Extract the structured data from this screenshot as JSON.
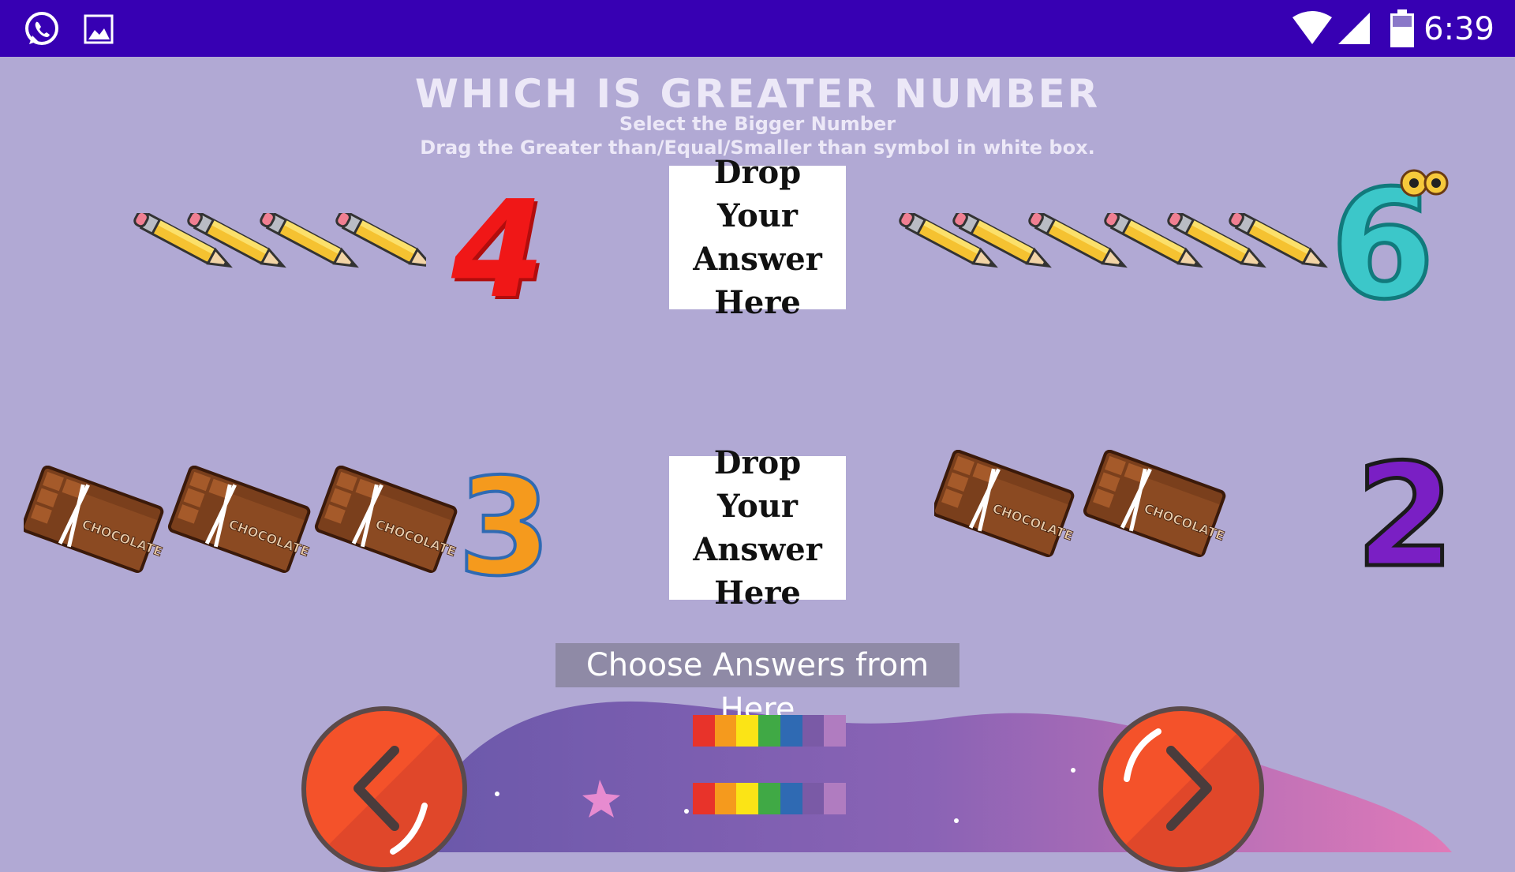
{
  "status_bar": {
    "time": "6:39",
    "left_icons": [
      "whatsapp-icon",
      "gallery-icon"
    ],
    "right_icons": [
      "wifi-icon",
      "signal-icon",
      "battery-icon"
    ]
  },
  "header": {
    "title": "WHICH IS GREATER NUMBER",
    "subtitle": "Select the Bigger Number",
    "instruction": "Drag the Greater than/Equal/Smaller than symbol in white box."
  },
  "questions": [
    {
      "left": {
        "item": "pencil",
        "count": 4,
        "numeral": "4",
        "numeral_color": "#f01717"
      },
      "drop_box": [
        "Drop Your",
        "Answer",
        "Here"
      ],
      "right": {
        "item": "pencil",
        "count": 6,
        "numeral": "6",
        "numeral_color": "#3cc7c9"
      }
    },
    {
      "left": {
        "item": "chocolate",
        "count": 3,
        "numeral": "3",
        "numeral_color": "rainbow"
      },
      "drop_box": [
        "Drop Your",
        "Answer",
        "Here"
      ],
      "right": {
        "item": "chocolate",
        "count": 2,
        "numeral": "2",
        "numeral_color": "#7a1fc4"
      }
    }
  ],
  "answers": {
    "label": "Choose Answers from Here",
    "options": [
      "equal-sign"
    ]
  },
  "nav": {
    "prev": "chevron-left-icon",
    "next": "chevron-right-icon"
  },
  "colors": {
    "status_bar": "#3700b3",
    "background": "#b1a9d4",
    "nav_button": "#f4522a",
    "rainbow": [
      "#e8332a",
      "#f59a1d",
      "#fbe416",
      "#40a945",
      "#2f6ab3",
      "#7a5aa6",
      "#b07cc0"
    ]
  }
}
